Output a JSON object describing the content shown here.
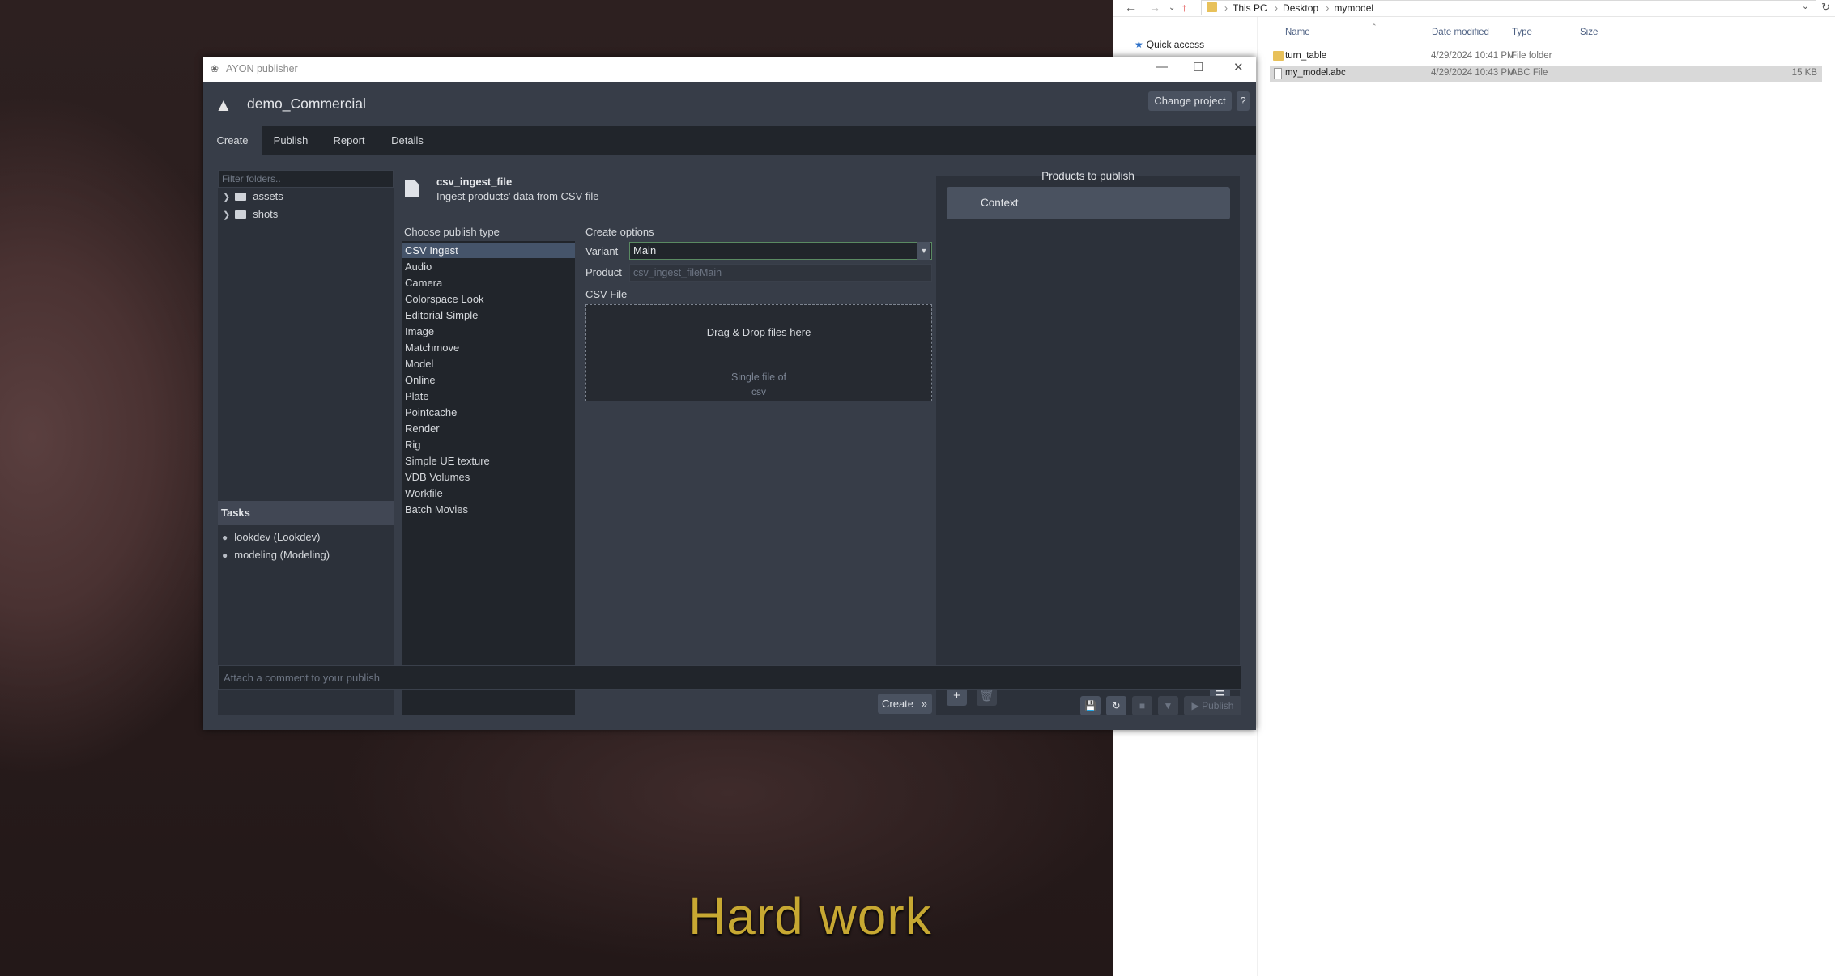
{
  "desktop": {
    "caption": "Hard work"
  },
  "explorer": {
    "breadcrumbs": [
      "This PC",
      "Desktop",
      "mymodel"
    ],
    "nav": {
      "quick_access": "Quick access"
    },
    "columns": {
      "name": "Name",
      "modified": "Date modified",
      "type": "Type",
      "size": "Size"
    },
    "rows": [
      {
        "name": "turn_table",
        "modified": "4/29/2024 10:41 PM",
        "type": "File folder",
        "size": ""
      },
      {
        "name": "my_model.abc",
        "modified": "4/29/2024 10:43 PM",
        "type": "ABC File",
        "size": "15 KB"
      }
    ]
  },
  "publisher": {
    "window_title": "AYON publisher",
    "project_name": "demo_Commercial",
    "change_project_label": "Change project",
    "help_label": "?",
    "tabs": [
      "Create",
      "Publish",
      "Report",
      "Details"
    ],
    "active_tab": "Create",
    "folders": {
      "filter_placeholder": "Filter folders..",
      "items": [
        "assets",
        "shots"
      ]
    },
    "tasks": {
      "header": "Tasks",
      "items": [
        "lookdev (Lookdev)",
        "modeling (Modeling)"
      ]
    },
    "creator": {
      "name": "csv_ingest_file",
      "description": "Ingest products' data from CSV file"
    },
    "publish_types": {
      "header": "Choose publish type",
      "items": [
        "CSV Ingest",
        "Audio",
        "Camera",
        "Colorspace Look",
        "Editorial Simple",
        "Image",
        "Matchmove",
        "Model",
        "Online",
        "Plate",
        "Pointcache",
        "Render",
        "Rig",
        "Simple UE texture",
        "VDB Volumes",
        "Workfile",
        "Batch Movies"
      ],
      "selected": "CSV Ingest"
    },
    "create_options": {
      "header": "Create options",
      "variant_label": "Variant",
      "variant_value": "Main",
      "product_label": "Product",
      "product_value": "csv_ingest_fileMain",
      "csv_label": "CSV File",
      "drop_text": "Drag & Drop files here",
      "drop_hint_1": "Single file of",
      "drop_hint_2": "csv",
      "create_button": "Create"
    },
    "products": {
      "header": "Products to publish",
      "items": [
        "Context"
      ]
    },
    "comment_placeholder": "Attach a comment to your publish",
    "publish_button": "Publish",
    "colors": {
      "window_bg": "#373d48",
      "panel_bg": "#2c313a",
      "selection": "#45546a",
      "button": "#4a5260"
    }
  }
}
